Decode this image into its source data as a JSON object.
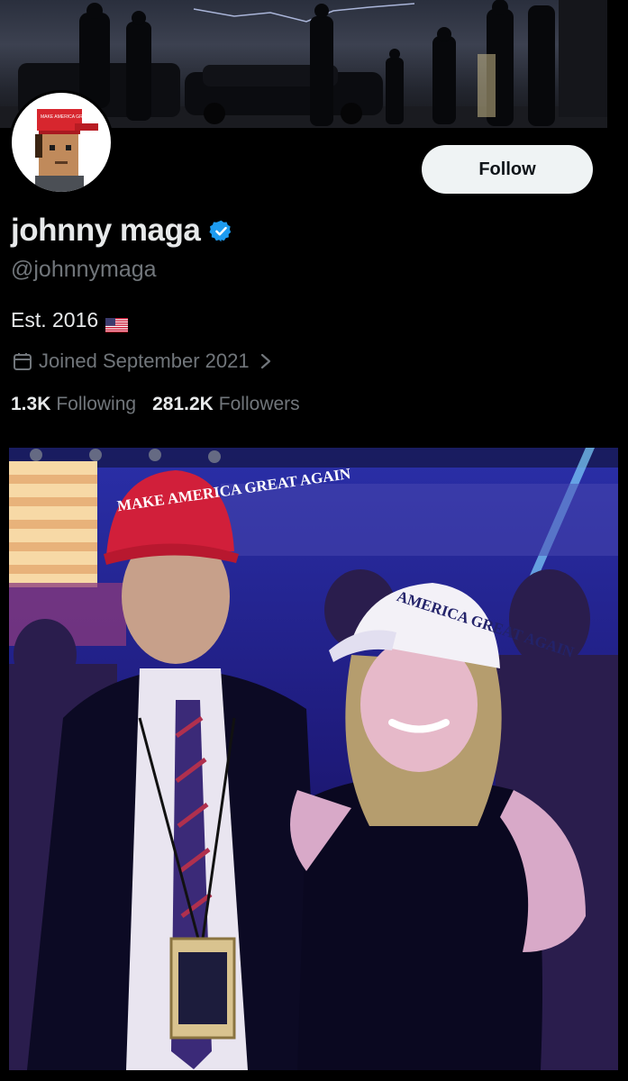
{
  "profile": {
    "display_name": "johnny maga",
    "handle": "@johnnymaga",
    "bio": "Est. 2016",
    "joined": "Joined September 2021",
    "verified": true,
    "avatar_cap_text": "MAKE AMERICA GREAT AGAIN"
  },
  "actions": {
    "follow_label": "Follow"
  },
  "stats": {
    "following_count": "1.3K",
    "following_label": "Following",
    "followers_count": "281.2K",
    "followers_label": "Followers"
  },
  "media": {
    "red_cap_text": "MAKE AMERICA GREAT AGAIN",
    "white_cap_text": "AMERICA GREAT AGAIN"
  },
  "colors": {
    "background": "#000000",
    "primary_text": "#e7e9ea",
    "secondary_text": "#71767b",
    "verified_blue": "#1d9bf0",
    "follow_button_bg": "#eff3f4"
  },
  "icons": {
    "verified": "verified-badge-icon",
    "flag": "us-flag-icon",
    "calendar": "calendar-icon",
    "chevron": "chevron-right-icon"
  }
}
